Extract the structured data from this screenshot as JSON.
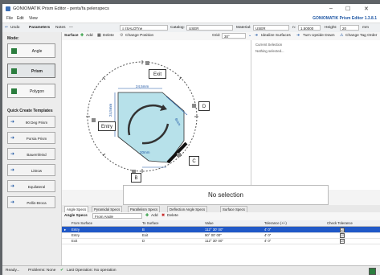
{
  "window": {
    "title": "GONIOMATIK Prism Editor - penta'fa pelenspecs",
    "brand": "GONIOMATIK Prism Editor 1.3.8.1",
    "controls": [
      "–",
      "☐",
      "✕"
    ]
  },
  "menu": {
    "file": "File",
    "edit": "Edit",
    "view": "View"
  },
  "toolbar": {
    "undo": "Undo",
    "params": "Parameters",
    "notes": "Notes",
    "notes_value": "—",
    "glass": "≡ (SALOTne",
    "catalog_label": "Catalog:",
    "catalog": "USER",
    "material_label": "Material:",
    "material": "USER",
    "n_label": "n:",
    "n_value": "1,50000",
    "height_label": "Height:",
    "height_value": "20",
    "unit": "mm"
  },
  "sidebar": {
    "mode_label": "Mode:",
    "modes": [
      "Angle",
      "Prism",
      "Polygon"
    ],
    "quick_label": "Quick Create Templates",
    "templates": [
      "90 Deg Prism",
      "Porsia Prism",
      "Bauernfeind",
      "Littrow",
      "Equilateral",
      "Pellin-Broca"
    ]
  },
  "surface_bar": {
    "label": "Surface",
    "add": "Add",
    "delete": "Delete",
    "change": "Change Position",
    "grid_label": "Grid:",
    "grid_value": "30°",
    "idealize": "Idealize Surfaces",
    "upside": "Turn Upside Down",
    "order": "Change Tag Order"
  },
  "canvas": {
    "tags": {
      "exit": "Exit",
      "entry": "Entry",
      "d": "D",
      "c": "C",
      "b": "B"
    },
    "dims": {
      "top": "24,5mm",
      "left": "24,5mm",
      "right": "8mm",
      "bottom": "20mm"
    }
  },
  "selection_panel": {
    "title": "Current Selection",
    "hint": "Nothing selected..."
  },
  "no_selection": "No selection",
  "tabs": [
    "Angle Specs",
    "Pyramidal Specs",
    "Parallelism Specs",
    "Deflection Angle Specs",
    "Surface Specs"
  ],
  "specbar": {
    "label": "Angle Specs",
    "dropdown": "From Angle",
    "add": "Add",
    "delete": "Delete"
  },
  "table": {
    "headers": [
      "From Surface",
      "To Surface",
      "Value",
      "Tolerance (+/-)",
      "Check Tolerance"
    ],
    "rows": [
      {
        "from": "Entry",
        "to": "B",
        "value": "112° 30' 00\"",
        "tol": "4' 0\"",
        "check": "☑"
      },
      {
        "from": "Entry",
        "to": "Exit",
        "value": "90° 00' 00\"",
        "tol": "4' 0\"",
        "check": "☑"
      },
      {
        "from": "Exit",
        "to": "D",
        "value": "112° 30' 00\"",
        "tol": "4' 0\"",
        "check": "☑"
      }
    ]
  },
  "status": {
    "ready": "Ready...",
    "problems": "Problems: None",
    "last_op": "Last Operation: No operation"
  }
}
